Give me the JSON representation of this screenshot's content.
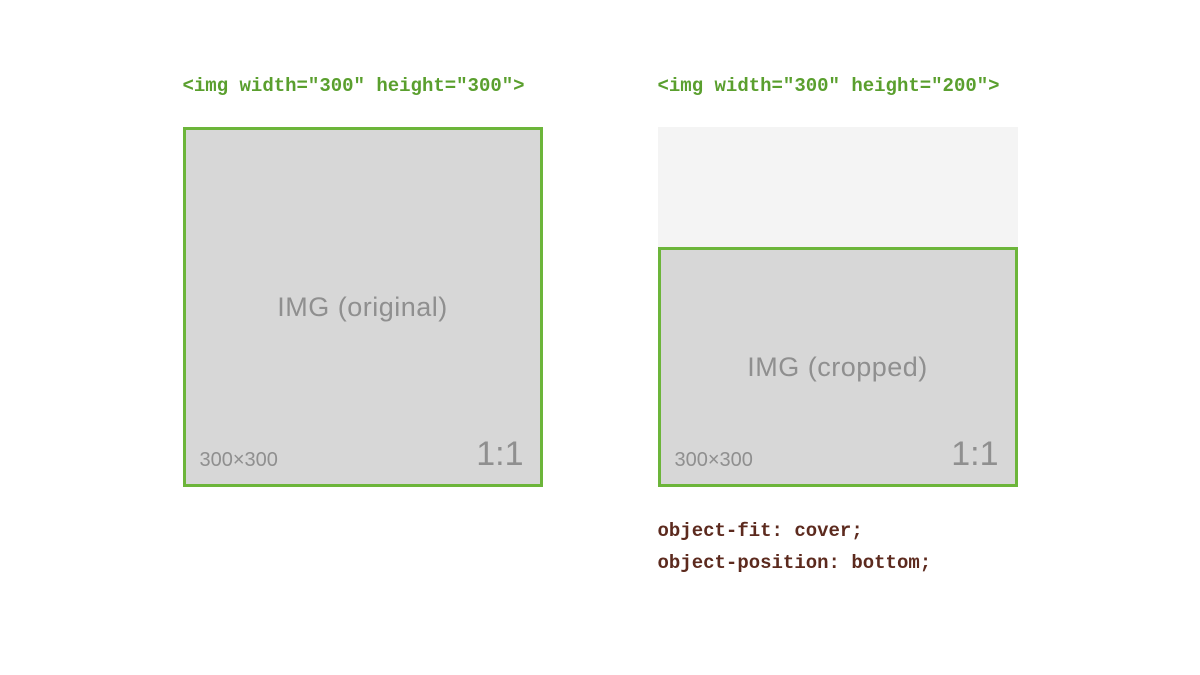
{
  "left": {
    "header": "<img width=\"300\" height=\"300\">",
    "label": "IMG (original)",
    "size": "300×300",
    "ratio": "1:1"
  },
  "right": {
    "header": "<img width=\"300\" height=\"200\">",
    "label": "IMG (cropped)",
    "size": "300×300",
    "ratio": "1:1",
    "css_line1": "object-fit: cover;",
    "css_line2": "object-position: bottom;"
  }
}
